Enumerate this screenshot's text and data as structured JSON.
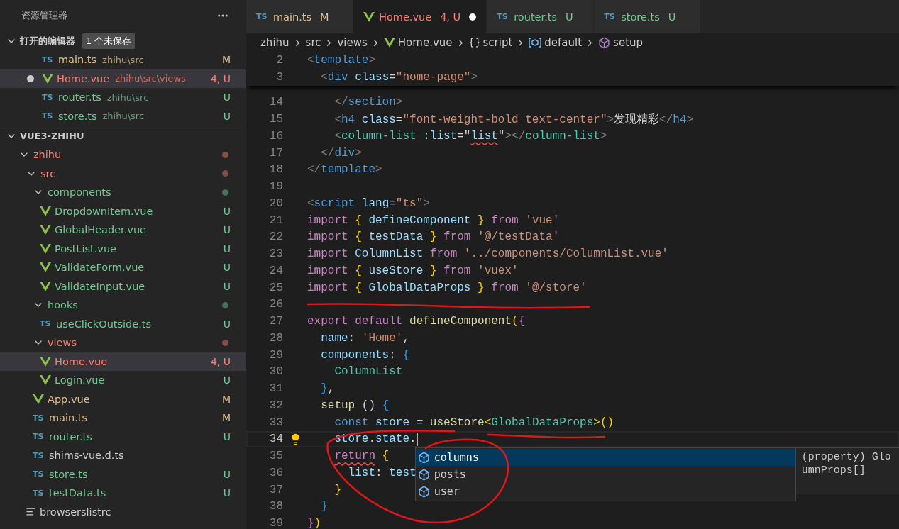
{
  "sidebar": {
    "title": "资源管理器",
    "open_editors": {
      "label": "打开的编辑器",
      "badge": "1 个未保存",
      "expanded": true,
      "items": [
        {
          "kind": "ts",
          "icon_text": "TS",
          "name": "main.ts",
          "path": "zhihu\\src",
          "color": "#e2c08d",
          "status_text": "M",
          "dirty": false,
          "selected": false
        },
        {
          "kind": "vue",
          "name": "Home.vue",
          "path": "zhihu\\src\\views",
          "color": "#f88070",
          "status_text": "4, U",
          "dirty": true,
          "selected": true
        },
        {
          "kind": "ts",
          "icon_text": "TS",
          "name": "router.ts",
          "path": "zhihu\\src",
          "color": "#73c991",
          "status_text": "U",
          "dirty": false,
          "selected": false
        },
        {
          "kind": "ts",
          "icon_text": "TS",
          "name": "store.ts",
          "path": "zhihu\\src",
          "color": "#73c991",
          "status_text": "U",
          "dirty": false,
          "selected": false
        }
      ]
    },
    "project": {
      "label": "VUE3-ZHIHU",
      "expanded": true,
      "tree": [
        {
          "kind": "folder",
          "name": "zhihu",
          "color": "#f88070",
          "expanded": true,
          "selected": false,
          "children": [
            {
              "kind": "folder",
              "name": "src",
              "color": "#f88070",
              "expanded": true,
              "selected": false,
              "children": [
                {
                  "kind": "folder",
                  "name": "components",
                  "color": "#73c991",
                  "expanded": true,
                  "selected": false,
                  "children": [
                    {
                      "kind": "vue",
                      "name": "DropdownItem.vue",
                      "color": "#73c991",
                      "status_text": "U",
                      "selected": false
                    },
                    {
                      "kind": "vue",
                      "name": "GlobalHeader.vue",
                      "color": "#73c991",
                      "status_text": "U",
                      "selected": false
                    },
                    {
                      "kind": "vue",
                      "name": "PostList.vue",
                      "color": "#73c991",
                      "status_text": "U",
                      "selected": false
                    },
                    {
                      "kind": "vue",
                      "name": "ValidateForm.vue",
                      "color": "#73c991",
                      "status_text": "U",
                      "selected": false
                    },
                    {
                      "kind": "vue",
                      "name": "ValidateInput.vue",
                      "color": "#73c991",
                      "status_text": "U",
                      "selected": false
                    }
                  ]
                },
                {
                  "kind": "folder",
                  "name": "hooks",
                  "color": "#73c991",
                  "expanded": true,
                  "selected": false,
                  "children": [
                    {
                      "kind": "ts",
                      "icon_text": "TS",
                      "name": "useClickOutside.ts",
                      "color": "#73c991",
                      "status_text": "U",
                      "selected": false
                    }
                  ]
                },
                {
                  "kind": "folder",
                  "name": "views",
                  "color": "#f88070",
                  "expanded": true,
                  "selected": false,
                  "children": [
                    {
                      "kind": "vue",
                      "name": "Home.vue",
                      "color": "#f88070",
                      "status_text": "4, U",
                      "selected": true
                    },
                    {
                      "kind": "vue",
                      "name": "Login.vue",
                      "color": "#73c991",
                      "status_text": "U",
                      "selected": false
                    }
                  ]
                },
                {
                  "kind": "vue",
                  "name": "App.vue",
                  "color": "#e2c08d",
                  "status_text": "M",
                  "selected": false
                },
                {
                  "kind": "ts",
                  "icon_text": "TS",
                  "name": "main.ts",
                  "color": "#e2c08d",
                  "status_text": "M",
                  "selected": false
                },
                {
                  "kind": "ts",
                  "icon_text": "TS",
                  "name": "router.ts",
                  "color": "#73c991",
                  "status_text": "U",
                  "selected": false
                },
                {
                  "kind": "ts",
                  "icon_text": "TS",
                  "name": "shims-vue.d.ts",
                  "color": "#cccccc",
                  "selected": false
                },
                {
                  "kind": "ts",
                  "icon_text": "TS",
                  "name": "store.ts",
                  "color": "#73c991",
                  "status_text": "U",
                  "selected": false
                },
                {
                  "kind": "ts",
                  "icon_text": "TS",
                  "name": "testData.ts",
                  "color": "#73c991",
                  "status_text": "U",
                  "selected": false
                }
              ]
            },
            {
              "kind": "config",
              "name": "browserslistrc",
              "color": "#cccccc",
              "selected": false
            }
          ]
        }
      ]
    }
  },
  "tabs": [
    {
      "kind": "ts",
      "icon_text": "TS",
      "label": "main.ts",
      "color": "#e2c08d",
      "status_text": "M",
      "dirty": false,
      "selected": false
    },
    {
      "kind": "vue",
      "label": "Home.vue",
      "color": "#f88070",
      "status_text": "4, U",
      "dirty": true,
      "selected": true
    },
    {
      "kind": "ts",
      "icon_text": "TS",
      "label": "router.ts",
      "color": "#73c991",
      "status_text": "U",
      "dirty": false,
      "selected": false
    },
    {
      "kind": "ts",
      "icon_text": "TS",
      "label": "store.ts",
      "color": "#73c991",
      "status_text": "U",
      "dirty": false,
      "selected": false
    }
  ],
  "breadcrumb": [
    {
      "kind": "folder",
      "label": "zhihu"
    },
    {
      "kind": "folder",
      "label": "src"
    },
    {
      "kind": "folder",
      "label": "views"
    },
    {
      "kind": "vue",
      "label": "Home.vue"
    },
    {
      "kind": "braces",
      "label": "script"
    },
    {
      "kind": "variable",
      "label": "default"
    },
    {
      "kind": "method",
      "label": "setup"
    }
  ],
  "editor": {
    "sticky_lines": [
      {
        "number": "2",
        "tokens": [
          {
            "text": "<",
            "kind": "punct"
          },
          {
            "text": "template",
            "kind": "tag"
          },
          {
            "text": ">",
            "kind": "punct"
          }
        ]
      },
      {
        "number": "3",
        "tokens": [
          {
            "text": "  <",
            "kind": "punct"
          },
          {
            "text": "div",
            "kind": "tag"
          },
          {
            "text": " class",
            "kind": "attr"
          },
          {
            "text": "=",
            "kind": "text"
          },
          {
            "text": "\"home-page\"",
            "kind": "str"
          },
          {
            "text": ">",
            "kind": "punct"
          }
        ]
      }
    ],
    "lines": [
      {
        "number": "14",
        "tokens": [
          {
            "text": "    </",
            "kind": "punct"
          },
          {
            "text": "section",
            "kind": "tag"
          },
          {
            "text": ">",
            "kind": "punct"
          }
        ]
      },
      {
        "number": "15",
        "tokens": [
          {
            "text": "    <",
            "kind": "punct"
          },
          {
            "text": "h4",
            "kind": "tag"
          },
          {
            "text": " class",
            "kind": "attr"
          },
          {
            "text": "=",
            "kind": "text"
          },
          {
            "text": "\"font-weight-bold text-center\"",
            "kind": "str"
          },
          {
            "text": ">",
            "kind": "punct"
          },
          {
            "text": "发现精彩",
            "kind": "text"
          },
          {
            "text": "</",
            "kind": "punct"
          },
          {
            "text": "h4",
            "kind": "tag"
          },
          {
            "text": ">",
            "kind": "punct"
          }
        ]
      },
      {
        "number": "16",
        "tokens": [
          {
            "text": "    <",
            "kind": "punct"
          },
          {
            "text": "column-list",
            "kind": "type"
          },
          {
            "text": " :list",
            "kind": "attr"
          },
          {
            "text": "=\"",
            "kind": "text"
          },
          {
            "text": "list",
            "kind": "var",
            "squiggle": true
          },
          {
            "text": "\"",
            "kind": "text"
          },
          {
            "text": "></",
            "kind": "punct"
          },
          {
            "text": "column-list",
            "kind": "type"
          },
          {
            "text": ">",
            "kind": "punct"
          }
        ]
      },
      {
        "number": "17",
        "tokens": [
          {
            "text": "  </",
            "kind": "punct"
          },
          {
            "text": "div",
            "kind": "tag"
          },
          {
            "text": ">",
            "kind": "punct"
          }
        ]
      },
      {
        "number": "18",
        "tokens": [
          {
            "text": "</",
            "kind": "punct"
          },
          {
            "text": "template",
            "kind": "tag"
          },
          {
            "text": ">",
            "kind": "punct"
          }
        ]
      },
      {
        "number": "19"
      },
      {
        "number": "20",
        "tokens": [
          {
            "text": "<",
            "kind": "punct"
          },
          {
            "text": "script",
            "kind": "tag"
          },
          {
            "text": " lang",
            "kind": "attr"
          },
          {
            "text": "=",
            "kind": "text"
          },
          {
            "text": "\"ts\"",
            "kind": "str"
          },
          {
            "text": ">",
            "kind": "punct"
          }
        ]
      },
      {
        "number": "21",
        "tokens": [
          {
            "text": "import",
            "kind": "kw"
          },
          {
            "text": " {",
            "kind": "b1"
          },
          {
            "text": " defineComponent ",
            "kind": "var"
          },
          {
            "text": "}",
            "kind": "b1"
          },
          {
            "text": " from",
            "kind": "kw"
          },
          {
            "text": " 'vue'",
            "kind": "str"
          }
        ]
      },
      {
        "number": "22",
        "tokens": [
          {
            "text": "import",
            "kind": "kw"
          },
          {
            "text": " {",
            "kind": "b1"
          },
          {
            "text": " testData ",
            "kind": "var"
          },
          {
            "text": "}",
            "kind": "b1"
          },
          {
            "text": " from",
            "kind": "kw"
          },
          {
            "text": " '@/testData'",
            "kind": "str"
          }
        ]
      },
      {
        "number": "23",
        "tokens": [
          {
            "text": "import",
            "kind": "kw"
          },
          {
            "text": " ColumnList",
            "kind": "var"
          },
          {
            "text": " from",
            "kind": "kw"
          },
          {
            "text": " '../components/ColumnList.vue'",
            "kind": "str"
          }
        ]
      },
      {
        "number": "24",
        "tokens": [
          {
            "text": "import",
            "kind": "kw"
          },
          {
            "text": " {",
            "kind": "b1"
          },
          {
            "text": " useStore ",
            "kind": "var"
          },
          {
            "text": "}",
            "kind": "b1"
          },
          {
            "text": " from",
            "kind": "kw"
          },
          {
            "text": " 'vuex'",
            "kind": "str"
          }
        ]
      },
      {
        "number": "25",
        "tokens": [
          {
            "text": "import",
            "kind": "kw"
          },
          {
            "text": " {",
            "kind": "b1"
          },
          {
            "text": " GlobalDataProps ",
            "kind": "var"
          },
          {
            "text": "}",
            "kind": "b1"
          },
          {
            "text": " from",
            "kind": "kw"
          },
          {
            "text": " '@/store'",
            "kind": "str"
          }
        ]
      },
      {
        "number": "26"
      },
      {
        "number": "27",
        "tokens": [
          {
            "text": "export",
            "kind": "kw"
          },
          {
            "text": " default",
            "kind": "kw"
          },
          {
            "text": " defineComponent",
            "kind": "fn"
          },
          {
            "text": "(",
            "kind": "b1"
          },
          {
            "text": "{",
            "kind": "b2"
          }
        ]
      },
      {
        "number": "28",
        "tokens": [
          {
            "text": "  name",
            "kind": "var"
          },
          {
            "text": ": ",
            "kind": "text"
          },
          {
            "text": "'Home'",
            "kind": "str"
          },
          {
            "text": ",",
            "kind": "text"
          }
        ]
      },
      {
        "number": "29",
        "tokens": [
          {
            "text": "  components",
            "kind": "var"
          },
          {
            "text": ": ",
            "kind": "text"
          },
          {
            "text": "{",
            "kind": "b3"
          }
        ]
      },
      {
        "number": "30",
        "tokens": [
          {
            "text": "    ColumnList",
            "kind": "type"
          }
        ]
      },
      {
        "number": "31",
        "tokens": [
          {
            "text": "  }",
            "kind": "b3"
          },
          {
            "text": ",",
            "kind": "text"
          }
        ]
      },
      {
        "number": "32",
        "tokens": [
          {
            "text": "  setup",
            "kind": "fn"
          },
          {
            "text": " () ",
            "kind": "text"
          },
          {
            "text": "{",
            "kind": "b3"
          }
        ]
      },
      {
        "number": "33",
        "tokens": [
          {
            "text": "    const",
            "kind": "kwb"
          },
          {
            "text": " store",
            "kind": "var"
          },
          {
            "text": " = ",
            "kind": "text"
          },
          {
            "text": "useStore",
            "kind": "fn"
          },
          {
            "text": "<",
            "kind": "b1"
          },
          {
            "text": "GlobalDataProps",
            "kind": "type"
          },
          {
            "text": ">()",
            "kind": "b1"
          }
        ]
      },
      {
        "number": "34",
        "current": true,
        "lightbulb": true,
        "tokens": [
          {
            "text": "    store",
            "kind": "var"
          },
          {
            "text": ".",
            "kind": "text"
          },
          {
            "text": "state",
            "kind": "var"
          },
          {
            "text": ".",
            "kind": "text"
          }
        ]
      },
      {
        "number": "35",
        "tokens": [
          {
            "text": "    return",
            "kind": "kw",
            "squiggle": true
          },
          {
            "text": " {",
            "kind": "b1"
          }
        ]
      },
      {
        "number": "36",
        "tokens": [
          {
            "text": "      list",
            "kind": "var"
          },
          {
            "text": ": ",
            "kind": "text"
          },
          {
            "text": "test",
            "kind": "var"
          }
        ]
      },
      {
        "number": "37",
        "tokens": [
          {
            "text": "    }",
            "kind": "b1"
          }
        ]
      },
      {
        "number": "38",
        "tokens": [
          {
            "text": "  }",
            "kind": "b3"
          }
        ]
      },
      {
        "number": "39",
        "tokens": [
          {
            "text": "}",
            "kind": "b2"
          },
          {
            "text": ")",
            "kind": "b1"
          }
        ]
      }
    ],
    "suggestions": [
      {
        "label": "columns",
        "selected": true
      },
      {
        "label": "posts",
        "selected": false
      },
      {
        "label": "user",
        "selected": false
      }
    ],
    "suggestion_detail": [
      "(property) Glo",
      "umnProps[]"
    ]
  }
}
